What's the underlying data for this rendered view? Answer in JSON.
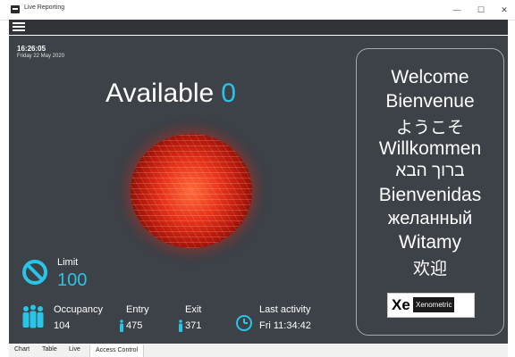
{
  "window": {
    "title": "Live Reporting",
    "minimize": "—",
    "maximize": "☐",
    "close": "✕"
  },
  "menu": {
    "icon": "hamburger-icon"
  },
  "status": {
    "time": "16:26:05",
    "date": "Friday 22 May 2020"
  },
  "available": {
    "label": "Available",
    "value": "0"
  },
  "traffic_light": {
    "state": "red",
    "color": "#e8331b"
  },
  "limit": {
    "label": "Limit",
    "value": "100",
    "icon": "no-entry-icon"
  },
  "stats": {
    "occupancy": {
      "label": "Occupancy",
      "value": "104",
      "icon": "people-icon"
    },
    "entry": {
      "label": "Entry",
      "value": "475",
      "icon": "person-icon"
    },
    "exit": {
      "label": "Exit",
      "value": "371",
      "icon": "person-icon"
    },
    "last_activity": {
      "label": "Last activity",
      "value": "Fri 11:34:42",
      "icon": "clock-icon"
    }
  },
  "welcome": [
    "Welcome",
    "Bienvenue",
    "ようこそ",
    "Willkommen",
    "ברוך הבא",
    "Bienvenidas",
    "желанный",
    "Witamy",
    "欢迎"
  ],
  "logo": {
    "mark": "Xe",
    "name": "Xenometric"
  },
  "tabs": [
    {
      "label": "Chart"
    },
    {
      "label": "Table"
    },
    {
      "label": "Live"
    },
    {
      "label": "Access Control",
      "active": true
    }
  ],
  "colors": {
    "accent": "#29c4e8",
    "panel": "#3d4148",
    "alert": "#e8331b"
  }
}
